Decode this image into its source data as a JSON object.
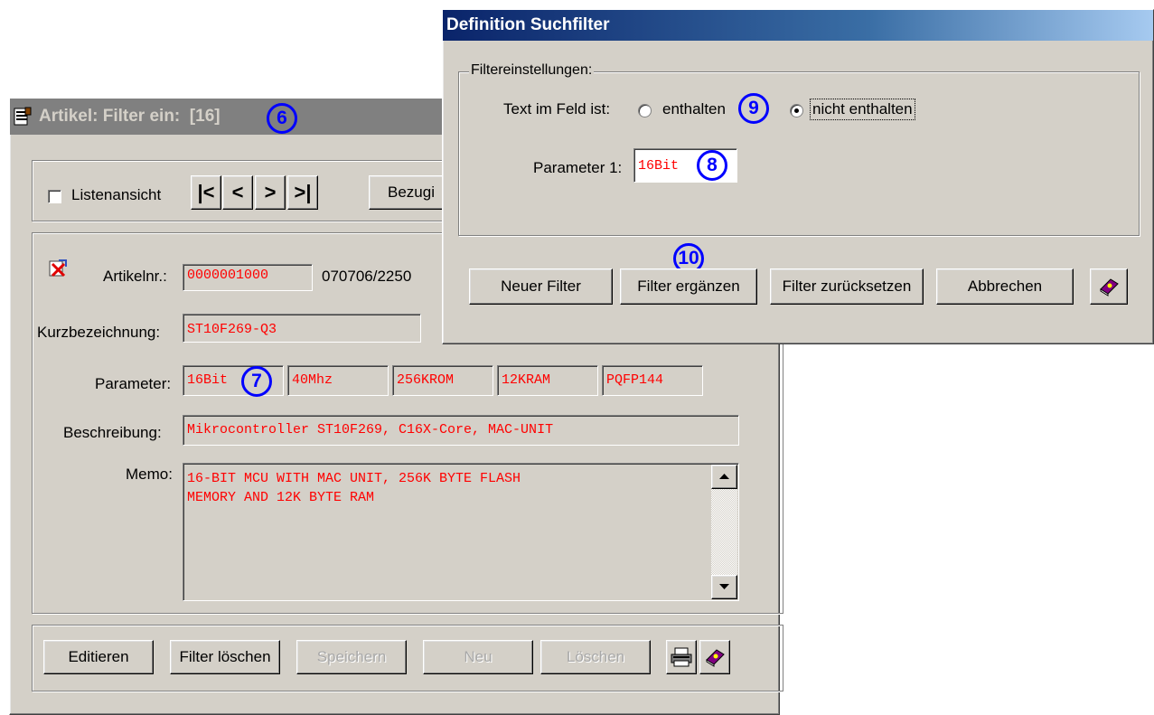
{
  "article_window": {
    "title": "Artikel: Filter ein:  [16]",
    "annotation_6": "6",
    "listview_label": "Listenansicht",
    "nav": {
      "first": "|<",
      "prev": "<",
      "next": ">",
      "last": ">|"
    },
    "bezug_label": "Bezugi",
    "artikelnr_label": "Artikelnr.:",
    "artikelnr_value": "0000001000",
    "artikelnr_extra": "070706/2250",
    "kurz_label": "Kurzbezeichnung:",
    "kurz_value": "ST10F269-Q3",
    "param_label": "Parameter:",
    "params": [
      "16Bit",
      "40Mhz",
      "256KROM",
      "12KRAM",
      "PQFP144"
    ],
    "annotation_7": "7",
    "beschreibung_label": "Beschreibung:",
    "beschreibung_value": "Mikrocontroller ST10F269, C16X-Core, MAC-UNIT",
    "memo_label": "Memo:",
    "memo_line1": "16-BIT MCU WITH MAC UNIT, 256K BYTE FLASH",
    "memo_line2": "MEMORY AND 12K BYTE RAM",
    "buttons": {
      "edit": "Editieren",
      "filter_delete": "Filter löschen",
      "save": "Speichern",
      "new": "Neu",
      "delete": "Löschen"
    }
  },
  "filter_dialog": {
    "title": "Definition Suchfilter",
    "group_label": "Filtereinstellungen:",
    "text_label": "Text im Feld ist:",
    "radio_contains": "enthalten",
    "radio_not_contains": "nicht enthalten",
    "selected": "nicht enthalten",
    "annotation_9": "9",
    "param_label": "Parameter 1:",
    "param_value": "16Bit",
    "annotation_8": "8",
    "annotation_10": "10",
    "buttons": {
      "new_filter": "Neuer Filter",
      "extend_filter": "Filter ergänzen",
      "reset_filter": "Filter zurücksetzen",
      "cancel": "Abbrechen"
    }
  },
  "colors": {
    "face": "#d4d0c8",
    "field_text": "#ff0000",
    "annotation": "#0000ff",
    "title_blue": "#0a246a"
  }
}
